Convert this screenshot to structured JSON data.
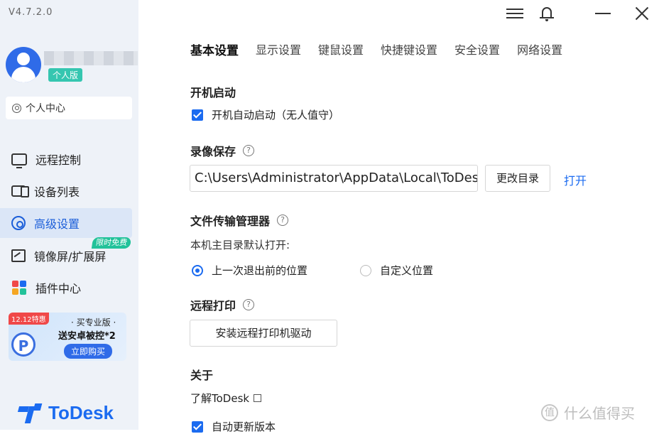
{
  "app": {
    "version": "V4.7.2.0"
  },
  "user": {
    "badge": "个人版",
    "center_label": "个人中心"
  },
  "nav": [
    {
      "label": "远程控制",
      "icon": "monitor-icon"
    },
    {
      "label": "设备列表",
      "icon": "devices-icon"
    },
    {
      "label": "高级设置",
      "icon": "settings-icon",
      "active": true
    },
    {
      "label": "镜像屏/扩展屏",
      "icon": "mirror-icon",
      "badge": "限时免费"
    },
    {
      "label": "插件中心",
      "icon": "plugin-icon"
    }
  ],
  "promo": {
    "tag": "12.12特惠",
    "line1": "· 买专业版 ·",
    "line2": "送安卓被控*2",
    "button": "立即购买"
  },
  "brand": {
    "name": "ToDesk",
    "color": "#1b6bf0"
  },
  "tabs": [
    "基本设置",
    "显示设置",
    "键鼠设置",
    "快捷键设置",
    "安全设置",
    "网络设置"
  ],
  "settings": {
    "startup": {
      "title": "开机启动",
      "checkbox_label": "开机自动启动（无人值守）",
      "checked": true
    },
    "recording": {
      "title": "录像保存",
      "path": "C:\\Users\\Administrator\\AppData\\Local\\ToDesk",
      "change_button": "更改目录",
      "open_link": "打开"
    },
    "file_transfer": {
      "title": "文件传输管理器",
      "default_label": "本机主目录默认打开:",
      "options": [
        "上一次退出前的位置",
        "自定义位置"
      ],
      "selected": 0
    },
    "remote_print": {
      "title": "远程打印",
      "install_button": "安装远程打印机驱动"
    },
    "about": {
      "title": "关于",
      "learn_link": "了解ToDesk",
      "auto_update_label": "自动更新版本",
      "auto_update_checked": true
    }
  },
  "watermark": {
    "text": "什么值得买",
    "icon_glyph": "值"
  },
  "colors": {
    "accent": "#1b6bf0",
    "sidebar_bg": "#eef2f8",
    "badge_green": "#22c29a"
  }
}
